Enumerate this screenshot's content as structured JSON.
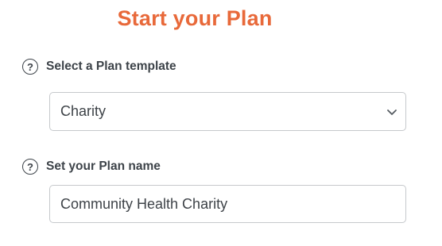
{
  "title": "Start your Plan",
  "template_field": {
    "label": "Select a Plan template",
    "help_icon": "question-circle-icon",
    "selected_value": "Charity",
    "dropdown_icon": "chevron-down-icon"
  },
  "name_field": {
    "label": "Set your Plan name",
    "help_icon": "question-circle-icon",
    "value": "Community Health Charity"
  },
  "colors": {
    "accent": "#e8693a",
    "text": "#3d4349",
    "border": "#c6c9cc"
  }
}
